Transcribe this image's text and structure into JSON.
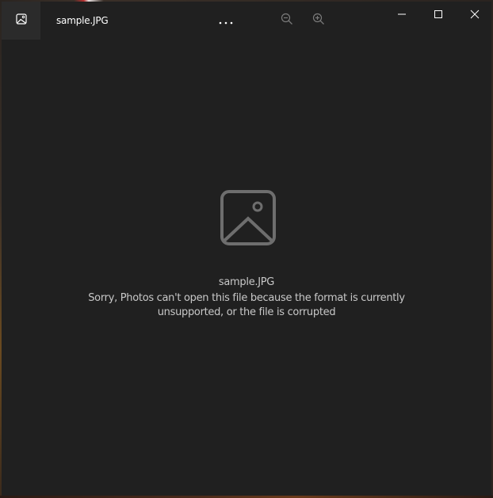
{
  "window": {
    "title": "sample.JPG",
    "background": "#202020"
  },
  "toolbar": {
    "icons": {
      "app": "photos-app-icon",
      "more": "more-options-icon",
      "zoom_out": "zoom-out-icon",
      "zoom_in": "zoom-in-icon"
    }
  },
  "window_controls": {
    "icons": {
      "minimize": "minimize-icon",
      "maximize": "maximize-icon",
      "close": "close-icon"
    }
  },
  "error": {
    "icon": "image-placeholder-icon",
    "filename": "sample.JPG",
    "message": "Sorry, Photos can't open this file because the format is currently unsupported, or the file is corrupted",
    "text_color": "#c8c8c8"
  }
}
